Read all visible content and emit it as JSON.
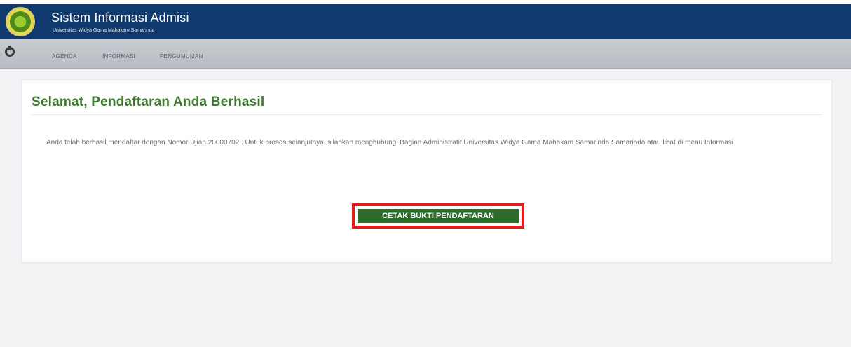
{
  "header": {
    "title": "Sistem Informasi Admisi",
    "subtitle": "Universitas Widya Gama Mahakam Samarinda",
    "logo": "university-seal-logo"
  },
  "nav": {
    "home_icon": "power-icon",
    "items": [
      {
        "label": "AGENDA"
      },
      {
        "label": "INFORMASI"
      },
      {
        "label": "PENGUMUMAN"
      }
    ]
  },
  "content": {
    "title": "Selamat, Pendaftaran Anda Berhasil",
    "message": "Anda telah berhasil mendaftar dengan Nomor Ujian 20000702 . Untuk proses selanjutnya, silahkan menghubungi Bagian Administratif Universitas Widya Gama Mahakam Samarinda Samarinda atau lihat di menu Informasi.",
    "button_label": "CETAK BUKTI PENDAFTARAN"
  },
  "colors": {
    "header_bg": "#103a6e",
    "title_green": "#3d7a2e",
    "button_green": "#2e6b2a",
    "highlight_red": "#e31b1b"
  }
}
